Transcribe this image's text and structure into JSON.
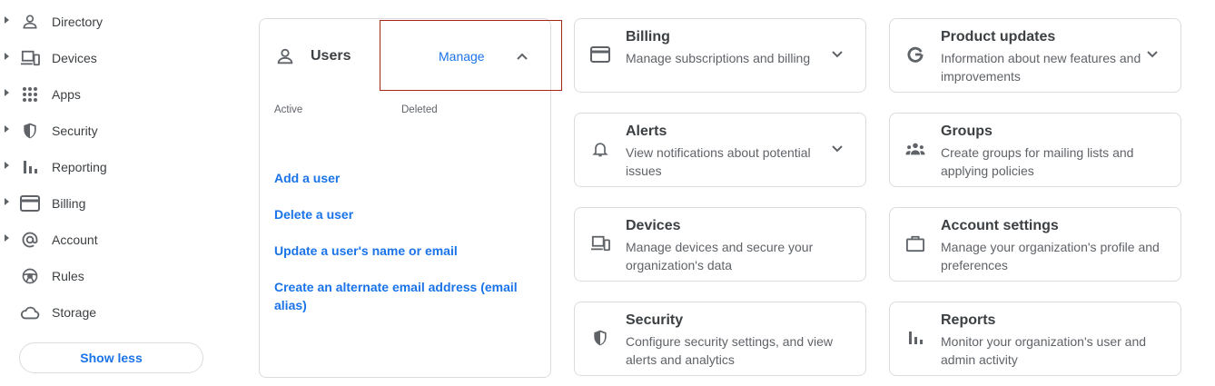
{
  "sidebar": {
    "items": [
      {
        "label": "Directory",
        "icon": "person-icon",
        "expandable": true
      },
      {
        "label": "Devices",
        "icon": "devices-icon",
        "expandable": true
      },
      {
        "label": "Apps",
        "icon": "apps-grid-icon",
        "expandable": true
      },
      {
        "label": "Security",
        "icon": "shield-icon",
        "expandable": true
      },
      {
        "label": "Reporting",
        "icon": "bar-chart-icon",
        "expandable": true
      },
      {
        "label": "Billing",
        "icon": "credit-card-icon",
        "expandable": true
      },
      {
        "label": "Account",
        "icon": "at-sign-icon",
        "expandable": true
      },
      {
        "label": "Rules",
        "icon": "steering-wheel-icon",
        "expandable": false
      },
      {
        "label": "Storage",
        "icon": "cloud-icon",
        "expandable": false
      }
    ],
    "show_less_label": "Show less"
  },
  "users_panel": {
    "title": "Users",
    "manage_label": "Manage",
    "stats": {
      "active_label": "Active",
      "deleted_label": "Deleted"
    },
    "actions": [
      "Add a user",
      "Delete a user",
      "Update a user's name or email",
      "Create an alternate email address (email alias)"
    ]
  },
  "cards": [
    {
      "title": "Billing",
      "desc": "Manage subscriptions and billing",
      "icon": "credit-card-icon",
      "expandable": true
    },
    {
      "title": "Product updates",
      "desc": "Information about new features and improvements",
      "icon": "google-g-icon",
      "expandable": true
    },
    {
      "title": "Alerts",
      "desc": "View notifications about potential issues",
      "icon": "bell-icon",
      "expandable": true
    },
    {
      "title": "Groups",
      "desc": "Create groups for mailing lists and applying policies",
      "icon": "groups-icon",
      "expandable": false
    },
    {
      "title": "Devices",
      "desc": "Manage devices and secure your organization's data",
      "icon": "devices-icon",
      "expandable": false
    },
    {
      "title": "Account settings",
      "desc": "Manage your organization's profile and preferences",
      "icon": "briefcase-icon",
      "expandable": false
    },
    {
      "title": "Security",
      "desc": "Configure security settings, and view alerts and analytics",
      "icon": "shield-icon",
      "expandable": false
    },
    {
      "title": "Reports",
      "desc": "Monitor your organization's user and admin activity",
      "icon": "bar-chart-icon",
      "expandable": false
    }
  ],
  "colors": {
    "accent": "#1a73e8",
    "highlight": "#a52714",
    "border": "#dadce0",
    "text": "#3c4043",
    "muted": "#5f6368"
  }
}
